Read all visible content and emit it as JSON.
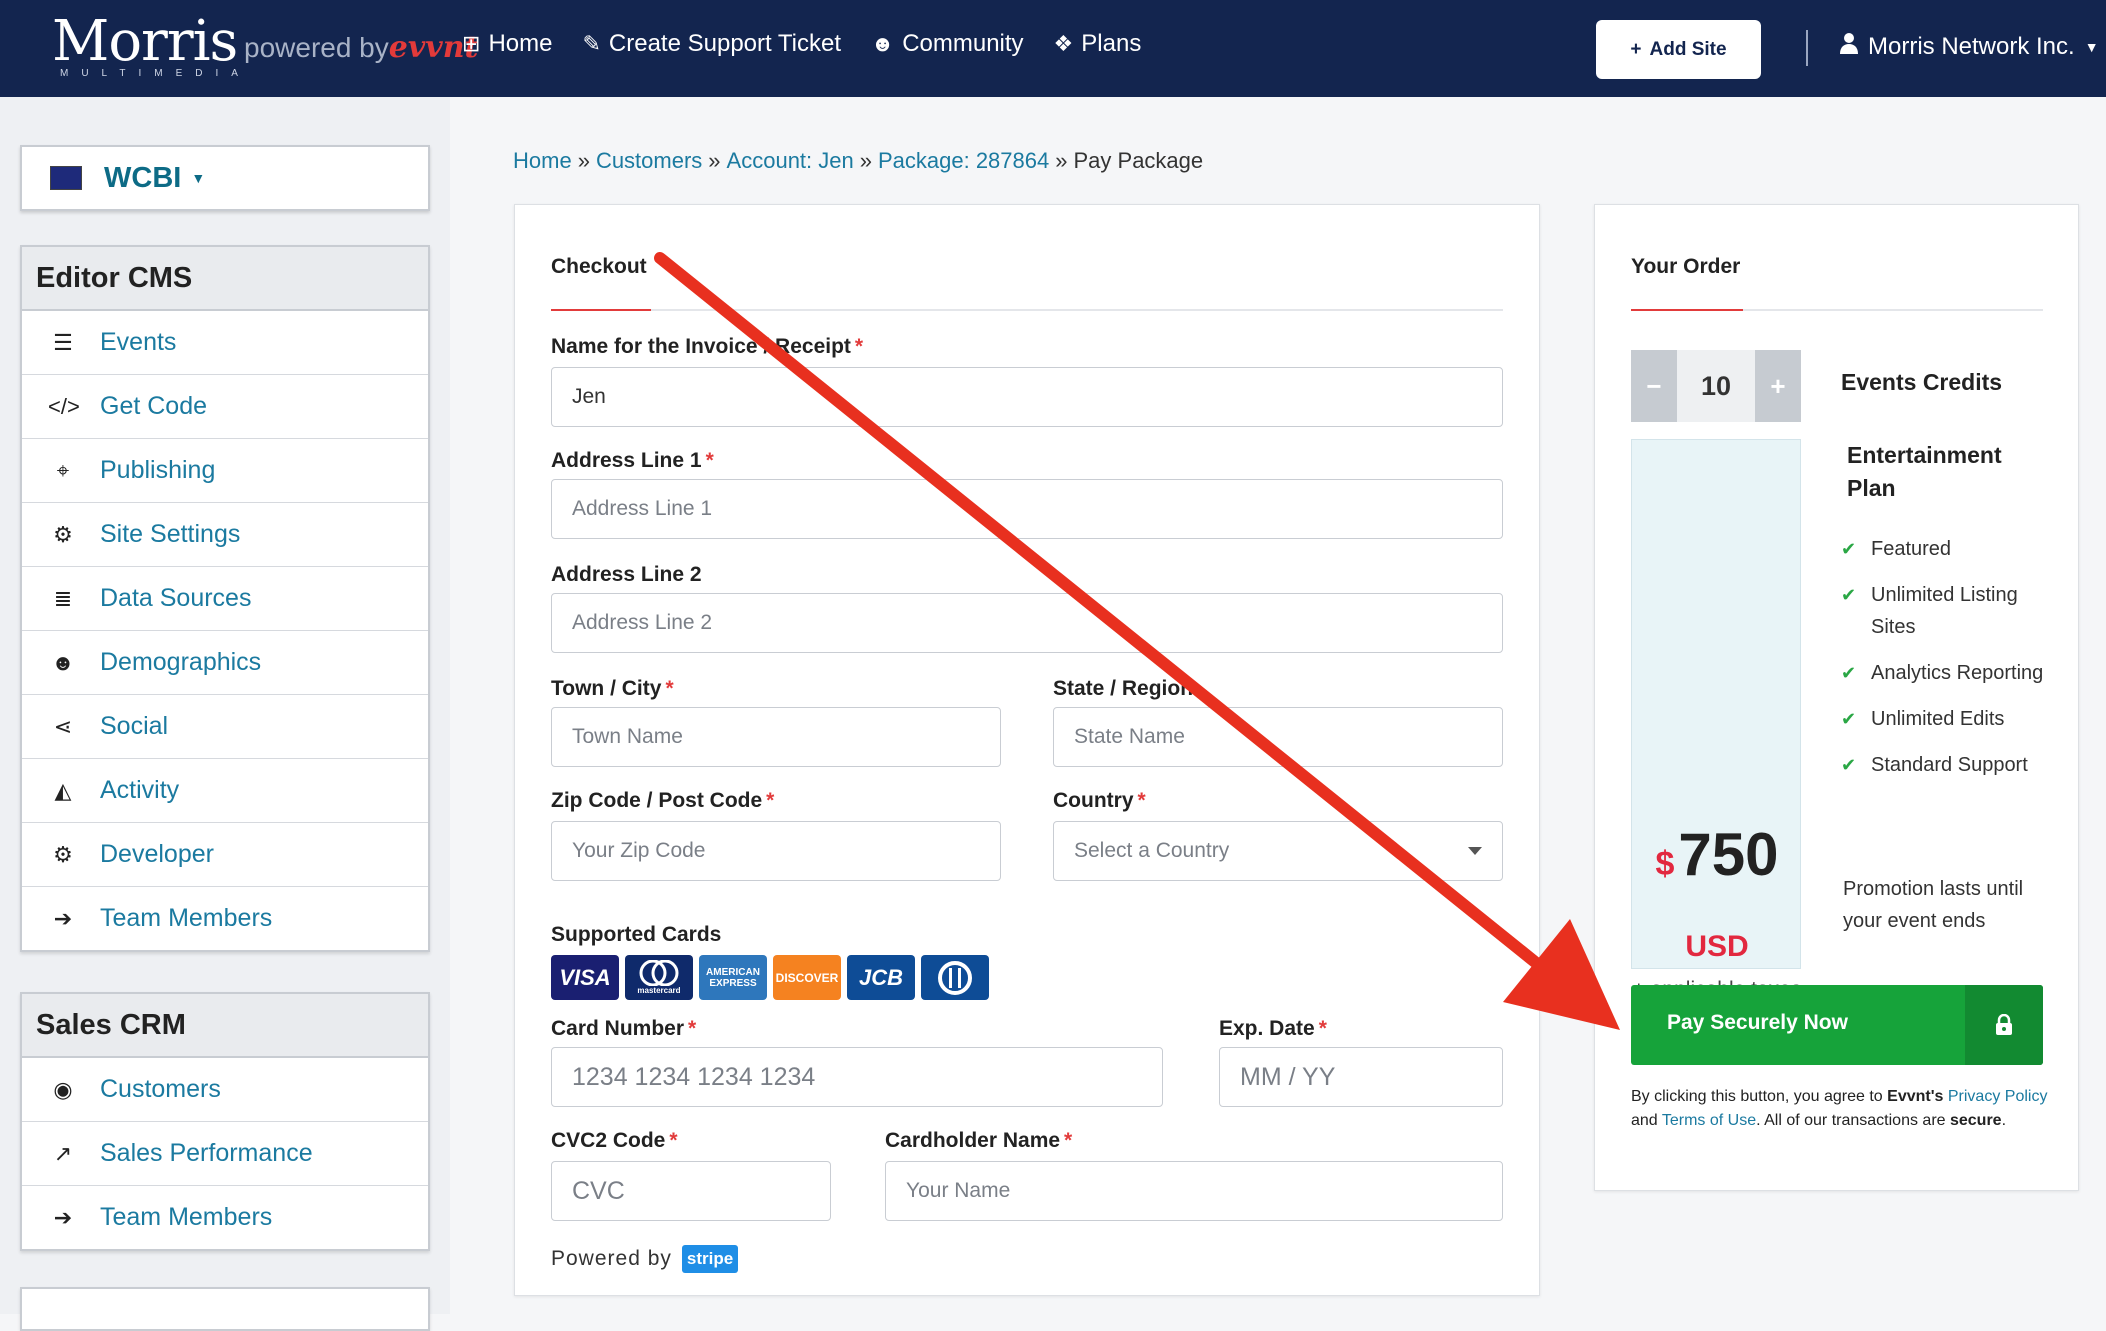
{
  "navbar": {
    "logo_main": "Morris",
    "logo_sub": "MULTIMEDIA",
    "powered_prefix": "powered by",
    "powered_brand": "evvnt",
    "links": [
      {
        "label": "Home",
        "icon": "sitemap-icon"
      },
      {
        "label": "Create Support Ticket",
        "icon": "ticket-icon"
      },
      {
        "label": "Community",
        "icon": "users-icon"
      },
      {
        "label": "Plans",
        "icon": "cubes-icon"
      }
    ],
    "add_site": "Add Site",
    "account_name": "Morris Network Inc."
  },
  "sidebar": {
    "site_name": "WCBI",
    "editor_title": "Editor CMS",
    "editor_items": [
      {
        "label": "Events",
        "icon": "list-icon"
      },
      {
        "label": "Get Code",
        "icon": "code-icon"
      },
      {
        "label": "Publishing",
        "icon": "crosshairs-icon"
      },
      {
        "label": "Site Settings",
        "icon": "cogs-icon"
      },
      {
        "label": "Data Sources",
        "icon": "database-icon"
      },
      {
        "label": "Demographics",
        "icon": "users-icon"
      },
      {
        "label": "Social",
        "icon": "share-icon"
      },
      {
        "label": "Activity",
        "icon": "area-chart-icon"
      },
      {
        "label": "Developer",
        "icon": "gear-icon"
      },
      {
        "label": "Team Members",
        "icon": "sign-in-icon"
      }
    ],
    "sales_title": "Sales CRM",
    "sales_items": [
      {
        "label": "Customers",
        "icon": "user-circle-icon"
      },
      {
        "label": "Sales Performance",
        "icon": "line-chart-icon"
      },
      {
        "label": "Team Members",
        "icon": "sign-in-icon"
      }
    ]
  },
  "breadcrumb": {
    "items": [
      "Home",
      "Customers",
      "Account: Jen",
      "Package: 287864"
    ],
    "current": "Pay Package",
    "separator": "»"
  },
  "checkout": {
    "title": "Checkout",
    "name_label": "Name for the Invoice / Receipt",
    "name_value": "Jen",
    "addr1_label": "Address Line 1",
    "addr1_placeholder": "Address Line 1",
    "addr2_label": "Address Line 2",
    "addr2_placeholder": "Address Line 2",
    "town_label": "Town / City",
    "town_placeholder": "Town Name",
    "state_label": "State / Region",
    "state_placeholder": "State Name",
    "zip_label": "Zip Code / Post Code",
    "zip_placeholder": "Your Zip Code",
    "country_label": "Country",
    "country_placeholder": "Select a Country",
    "cards_label": "Supported Cards",
    "cards": [
      "VISA",
      "mastercard",
      "AMERICAN EXPRESS",
      "DISCOVER",
      "JCB",
      "Diners"
    ],
    "card_number_label": "Card Number",
    "card_number_placeholder": "1234 1234 1234 1234",
    "exp_label": "Exp. Date",
    "exp_placeholder": "MM / YY",
    "cvc_label": "CVC2 Code",
    "cvc_placeholder": "CVC",
    "holder_label": "Cardholder Name",
    "holder_placeholder": "Your Name",
    "powered_by": "Powered by",
    "stripe": "stripe",
    "required_mark": "*"
  },
  "order": {
    "title": "Your Order",
    "quantity": "10",
    "minus": "−",
    "plus": "+",
    "credits_title": "Events Credits",
    "plan_title": "Entertainment Plan",
    "currency_symbol": "$",
    "price": "750",
    "currency": "USD",
    "tax_note": "+ applicable taxes",
    "features": [
      "Featured",
      "Unlimited Listing Sites",
      "Analytics Reporting",
      "Unlimited Edits",
      "Standard Support"
    ],
    "promo": "Promotion lasts until your event ends",
    "pay_button": "Pay Securely Now",
    "agree_prefix": "By clicking this button, you agree to ",
    "agree_brand": "Evvnt's",
    "privacy_link": "Privacy Policy",
    "agree_and": " and ",
    "terms_link": "Terms of Use",
    "agree_suffix": ". All of our transactions are ",
    "agree_secure": "secure",
    "agree_end": "."
  },
  "colors": {
    "navbar": "#13254f",
    "link": "#1b7aa0",
    "required": "#e23b3b",
    "pay_button": "#16a33a",
    "price_red": "#e2283f",
    "annotation_arrow": "#e8301f"
  }
}
